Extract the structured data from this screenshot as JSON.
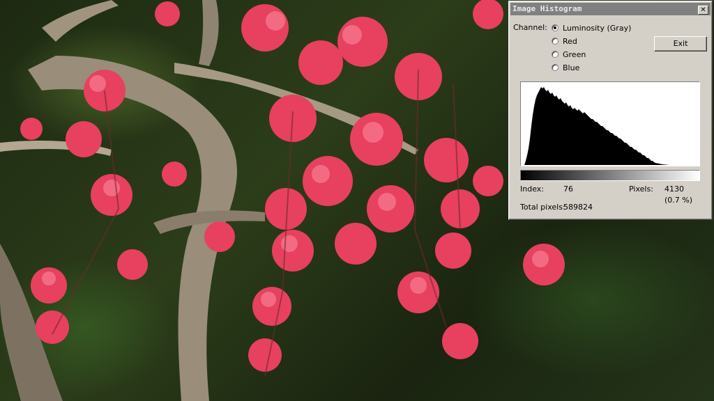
{
  "histogram_window": {
    "title": "Image Histogram",
    "close_glyph": "✕",
    "channel_label": "Channel:",
    "channels": [
      {
        "label": "Luminosity (Gray)",
        "checked": true
      },
      {
        "label": "Red",
        "checked": false
      },
      {
        "label": "Green",
        "checked": false
      },
      {
        "label": "Blue",
        "checked": false
      }
    ],
    "exit_label": "Exit",
    "index_label": "Index:",
    "index_value": "76",
    "pixels_label": "Pixels:",
    "pixels_value": "4130",
    "pixels_percent": "(0.7 %)",
    "total_label": "Total pixels:",
    "total_value": "589824"
  },
  "colors": {
    "blossom": "#e8405f",
    "blossom_light": "#f26b82",
    "bark": "#8a7d6c",
    "foliage": "#2c3d1a"
  }
}
